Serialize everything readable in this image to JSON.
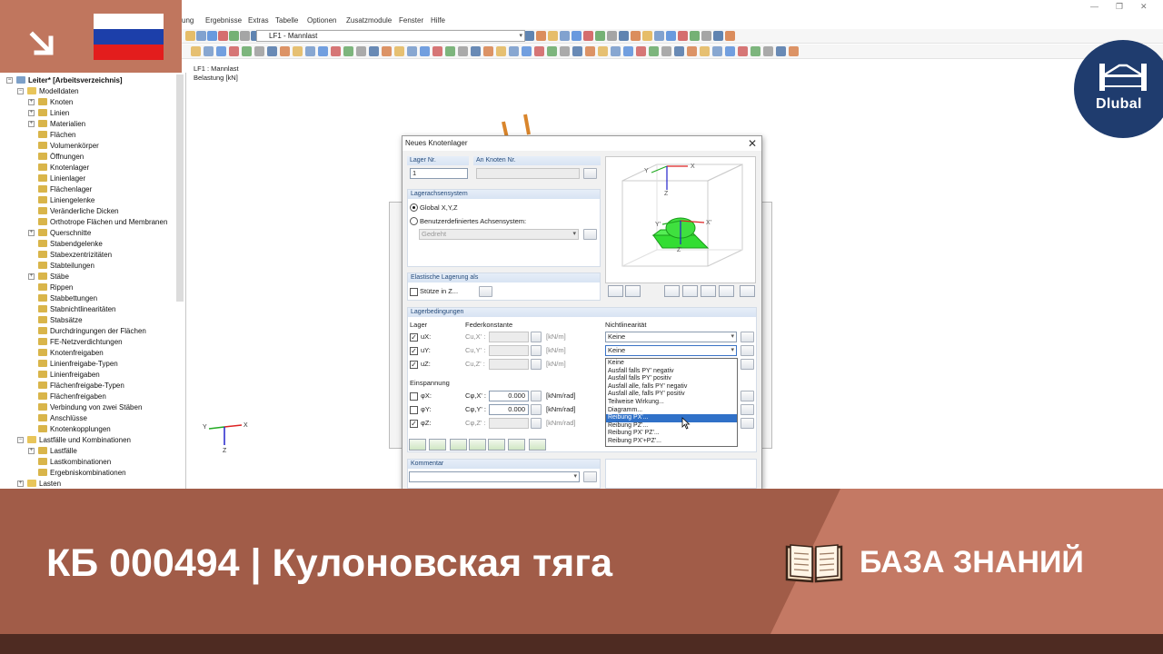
{
  "menu": {
    "items": [
      "ung",
      "Ergebnisse",
      "Extras",
      "Tabelle",
      "Optionen",
      "Zusatzmodule",
      "Fenster",
      "Hilfe"
    ]
  },
  "toolbar": {
    "load_case": "LF1 - Mannlast"
  },
  "canvas": {
    "info_line1": "LF1 : Mannlast",
    "info_line2": "Belastung [kN]",
    "axis_x": "X",
    "axis_y": "Y",
    "axis_z": "Z"
  },
  "navigator": {
    "root": "Leiter* [Arbeitsverzeichnis]",
    "items": [
      "Modelldaten",
      "Knoten",
      "Linien",
      "Materialien",
      "Flächen",
      "Volumenkörper",
      "Öffnungen",
      "Knotenlager",
      "Linienlager",
      "Flächenlager",
      "Liniengelenke",
      "Veränderliche Dicken",
      "Orthotrope Flächen und Membranen",
      "Querschnitte",
      "Stabendgelenke",
      "Stabexzentrizitäten",
      "Stabteilungen",
      "Stäbe",
      "Rippen",
      "Stabbettungen",
      "Stabnichtlinearitäten",
      "Stabsätze",
      "Durchdringungen der Flächen",
      "FE-Netzverdichtungen",
      "Knotenfreigaben",
      "Linienfreigabe-Typen",
      "Linienfreigaben",
      "Flächenfreigabe-Typen",
      "Flächenfreigaben",
      "Verbindung von zwei Stäben",
      "Anschlüsse",
      "Knotenkopplungen",
      "Lastfälle und Kombinationen",
      "Lastfälle",
      "Lastkombinationen",
      "Ergebniskombinationen",
      "Lasten"
    ]
  },
  "dialog": {
    "title": "Neues Knotenlager",
    "lager_nr_label": "Lager Nr.",
    "lager_nr_value": "1",
    "an_knoten_label": "An Knoten Nr.",
    "achsensystem_label": "Lagerachsensystem",
    "global_label": "Global X,Y,Z",
    "benutzer_label": "Benutzerdefiniertes Achsensystem:",
    "gedreht_label": "Gedreht",
    "elastisch_label": "Elastische Lagerung als",
    "stuetze_label": "Stütze in Z...",
    "bedingungen_label": "Lagerbedingungen",
    "col_lager": "Lager",
    "col_feder": "Federkonstante",
    "col_nichtlin": "Nichtlinearität",
    "einspannung_label": "Einspannung",
    "kommentar_label": "Kommentar",
    "rows_trans": [
      {
        "dof": "uX:",
        "c": "Cu,X' :",
        "value": "",
        "unit": "[kN/m]",
        "nl": "Keine"
      },
      {
        "dof": "uY:",
        "c": "Cu,Y' :",
        "value": "",
        "unit": "[kN/m]",
        "nl": "Keine"
      },
      {
        "dof": "uZ:",
        "c": "Cu,Z' :",
        "value": "",
        "unit": "[kN/m]",
        "nl": ""
      }
    ],
    "rows_rot": [
      {
        "dof": "φX:",
        "c": "Cφ,X' :",
        "value": "0.000",
        "unit": "[kNm/rad]"
      },
      {
        "dof": "φY:",
        "c": "Cφ,Y' :",
        "value": "0.000",
        "unit": "[kNm/rad]"
      },
      {
        "dof": "φZ:",
        "c": "Cφ,Z' :",
        "value": "",
        "unit": "[kNm/rad]"
      }
    ],
    "view_axes": {
      "x": "X",
      "y": "Y",
      "z": "Z",
      "x2": "X'",
      "y2": "Y'",
      "z2": "Z'"
    },
    "dropdown_options": [
      "Keine",
      "Ausfall falls PY' negativ",
      "Ausfall falls PY' positiv",
      "Ausfall alle, falls PY' negativ",
      "Ausfall alle, falls PY' positiv",
      "Teilweise Wirkung...",
      "Diagramm...",
      "Reibung PX'...",
      "Reibung PZ'...",
      "Reibung PX' PZ'...",
      "Reibung PX'+PZ'..."
    ],
    "dropdown_selected": 7
  },
  "overlay": {
    "title": "КБ 000494 | Кулоновская тяга",
    "category": "БАЗА ЗНАНИЙ",
    "brand": "Dlubal",
    "colors": {
      "primary": "#a15c48",
      "accent": "#c47964",
      "dark": "#4e2b22",
      "brand": "#1f3c6e"
    }
  }
}
